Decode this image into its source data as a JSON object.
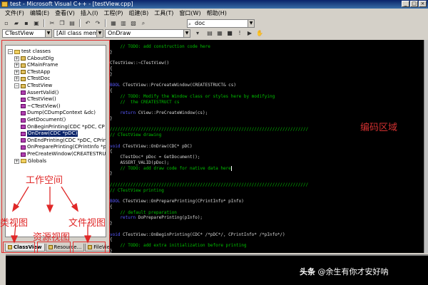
{
  "window": {
    "title": "test - Microsoft Visual C++ - [testView.cpp]",
    "controls": [
      "_",
      "□",
      "×"
    ]
  },
  "menu": [
    "文件(F)",
    "编辑(E)",
    "查看(V)",
    "插入(I)",
    "工程(P)",
    "组建(B)",
    "工具(T)",
    "窗口(W)",
    "帮助(H)"
  ],
  "toolbar": {
    "find_value": "doc"
  },
  "wizardbar": {
    "class_combo": "CTestView",
    "members_combo": "[All class members]",
    "function_combo": "OnDraw"
  },
  "workspace": {
    "tree": [
      {
        "label": "test classes",
        "level": 0,
        "type": "folder",
        "expander": "−"
      },
      {
        "label": "CAboutDlg",
        "level": 1,
        "type": "class",
        "expander": "+"
      },
      {
        "label": "CMainFrame",
        "level": 1,
        "type": "class",
        "expander": "+"
      },
      {
        "label": "CTestApp",
        "level": 1,
        "type": "class",
        "expander": "+"
      },
      {
        "label": "CTestDoc",
        "level": 1,
        "type": "class",
        "expander": "+"
      },
      {
        "label": "CTestView",
        "level": 1,
        "type": "class",
        "expander": "−"
      },
      {
        "label": "AssertValid()",
        "level": 2,
        "type": "fn"
      },
      {
        "label": "CTestView()",
        "level": 2,
        "type": "fn"
      },
      {
        "label": "~CTestView()",
        "level": 2,
        "type": "fn"
      },
      {
        "label": "Dump(CDumpContext &dc)",
        "level": 2,
        "type": "fn"
      },
      {
        "label": "GetDocument()",
        "level": 2,
        "type": "fn"
      },
      {
        "label": "OnBeginPrinting(CDC *pDC, CP",
        "level": 2,
        "type": "fn"
      },
      {
        "label": "OnDraw(CDC *pDC)",
        "level": 2,
        "type": "fn",
        "selected": true
      },
      {
        "label": "OnEndPrinting(CDC *pDC, CPrin",
        "level": 2,
        "type": "fn"
      },
      {
        "label": "OnPreparePrinting(CPrintInfo *p",
        "level": 2,
        "type": "fn"
      },
      {
        "label": "PreCreateWindow(CREATESTRU",
        "level": 2,
        "type": "fn"
      },
      {
        "label": "Globals",
        "level": 1,
        "type": "folder",
        "expander": "+"
      }
    ],
    "tabs": [
      "ClassView",
      "Resource...",
      "FileView"
    ]
  },
  "annotations": {
    "workspace": "工作空间",
    "class_view": "类视图",
    "resource_view": "资源视图",
    "file_view": "文件视图",
    "editor_area": "编码区域"
  },
  "code": [
    {
      "t": "comment",
      "s": "    // TODO: add construction code here"
    },
    {
      "t": "txt",
      "s": "}"
    },
    {
      "t": "txt",
      "s": ""
    },
    {
      "t": "txt",
      "s": "CTestView::~CTestView()"
    },
    {
      "t": "txt",
      "s": "{"
    },
    {
      "t": "txt",
      "s": "}"
    },
    {
      "t": "txt",
      "s": ""
    },
    {
      "t": "kwline",
      "kw": "BOOL",
      "s": " CTestView::PreCreateWindow(CREATESTRUCT& cs)"
    },
    {
      "t": "txt",
      "s": "{"
    },
    {
      "t": "comment",
      "s": "    // TODO: Modify the Window class or styles here by modifying"
    },
    {
      "t": "comment",
      "s": "    //  the CREATESTRUCT cs"
    },
    {
      "t": "txt",
      "s": ""
    },
    {
      "t": "kwline",
      "kw": "    return",
      "s": " CView::PreCreateWindow(cs);"
    },
    {
      "t": "txt",
      "s": "}"
    },
    {
      "t": "txt",
      "s": ""
    },
    {
      "t": "comment",
      "s": "/////////////////////////////////////////////////////////////////////////////"
    },
    {
      "t": "comment",
      "s": "// CTestView drawing"
    },
    {
      "t": "txt",
      "s": ""
    },
    {
      "t": "kwline",
      "kw": "void",
      "s": " CTestView::OnDraw(CDC* pDC)"
    },
    {
      "t": "txt",
      "s": "{"
    },
    {
      "t": "txt",
      "s": "    CTestDoc* pDoc = GetDocument();"
    },
    {
      "t": "txt",
      "s": "    ASSERT_VALID(pDoc);"
    },
    {
      "t": "cursorline",
      "s": "    // TODO: add draw code for native data here"
    },
    {
      "t": "txt",
      "s": "}"
    },
    {
      "t": "txt",
      "s": ""
    },
    {
      "t": "comment",
      "s": "/////////////////////////////////////////////////////////////////////////////"
    },
    {
      "t": "comment",
      "s": "// CTestView printing"
    },
    {
      "t": "txt",
      "s": ""
    },
    {
      "t": "kwline",
      "kw": "BOOL",
      "s": " CTestView::OnPreparePrinting(CPrintInfo* pInfo)"
    },
    {
      "t": "txt",
      "s": "{"
    },
    {
      "t": "comment",
      "s": "    // default preparation"
    },
    {
      "t": "kwline",
      "kw": "    return",
      "s": " DoPreparePrinting(pInfo);"
    },
    {
      "t": "txt",
      "s": "}"
    },
    {
      "t": "txt",
      "s": ""
    },
    {
      "t": "kwline",
      "kw": "void",
      "s": " CTestView::OnBeginPrinting(CDC* /*pDC*/, CPrintInfo* /*pInfo*/)"
    },
    {
      "t": "txt",
      "s": "{"
    },
    {
      "t": "comment",
      "s": "    // TODO: add extra initialization before printing"
    },
    {
      "t": "txt",
      "s": "}"
    }
  ],
  "watermark": {
    "brand": "头条",
    "handle": "@余生有你才安好呐"
  },
  "colors": {
    "annotation_red": "#e02828",
    "comment_green": "#00c000",
    "keyword_blue": "#5a5aff",
    "editor_bg": "#000000"
  }
}
